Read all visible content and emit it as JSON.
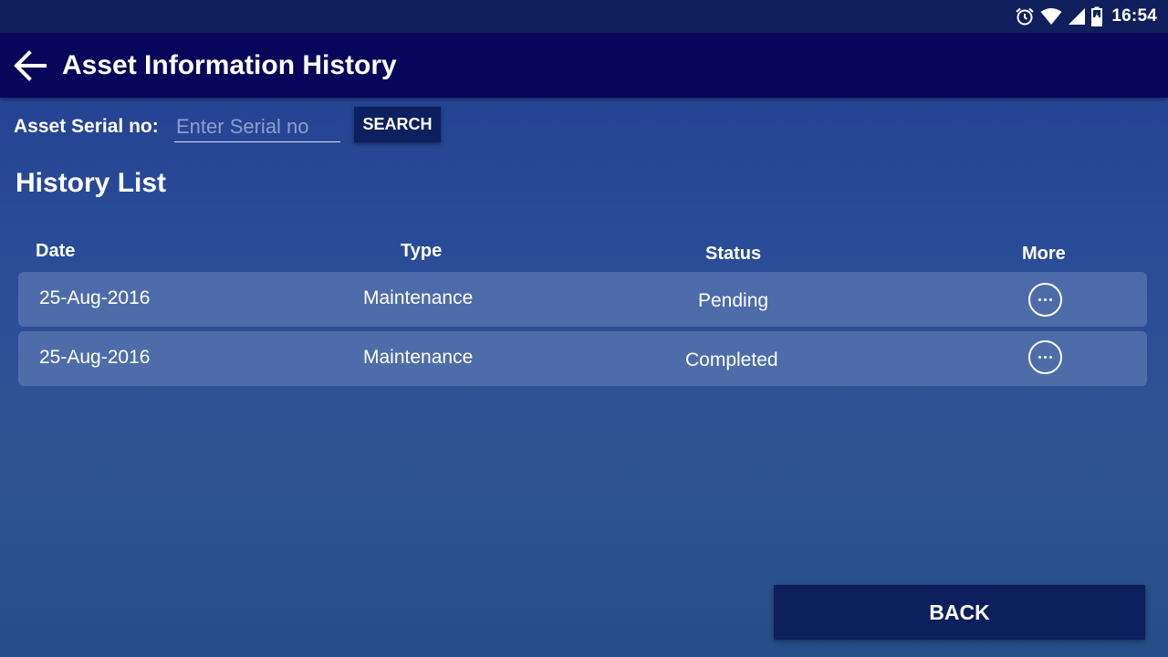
{
  "status_bar": {
    "time": "16:54",
    "icons": [
      "alarm-icon",
      "wifi-icon",
      "cell-signal-icon",
      "battery-icon"
    ]
  },
  "app_bar": {
    "title": "Asset Information History",
    "back_icon": "back-arrow-icon"
  },
  "search": {
    "label": "Asset Serial no:",
    "placeholder": "Enter Serial no",
    "value": "",
    "button_label": "SEARCH"
  },
  "history": {
    "title": "History List",
    "columns": [
      "Date",
      "Type",
      "Status",
      "More"
    ],
    "rows": [
      {
        "date": "25-Aug-2016",
        "type": "Maintenance",
        "status": "Pending"
      },
      {
        "date": "25-Aug-2016",
        "type": "Maintenance",
        "status": "Completed"
      }
    ]
  },
  "footer": {
    "back_label": "BACK"
  },
  "colors": {
    "app_bar": "#07065a",
    "status_bar": "#0e1f5c",
    "button": "#0c1f5e",
    "background_top": "#213d8e",
    "background_bottom": "#254e88"
  }
}
